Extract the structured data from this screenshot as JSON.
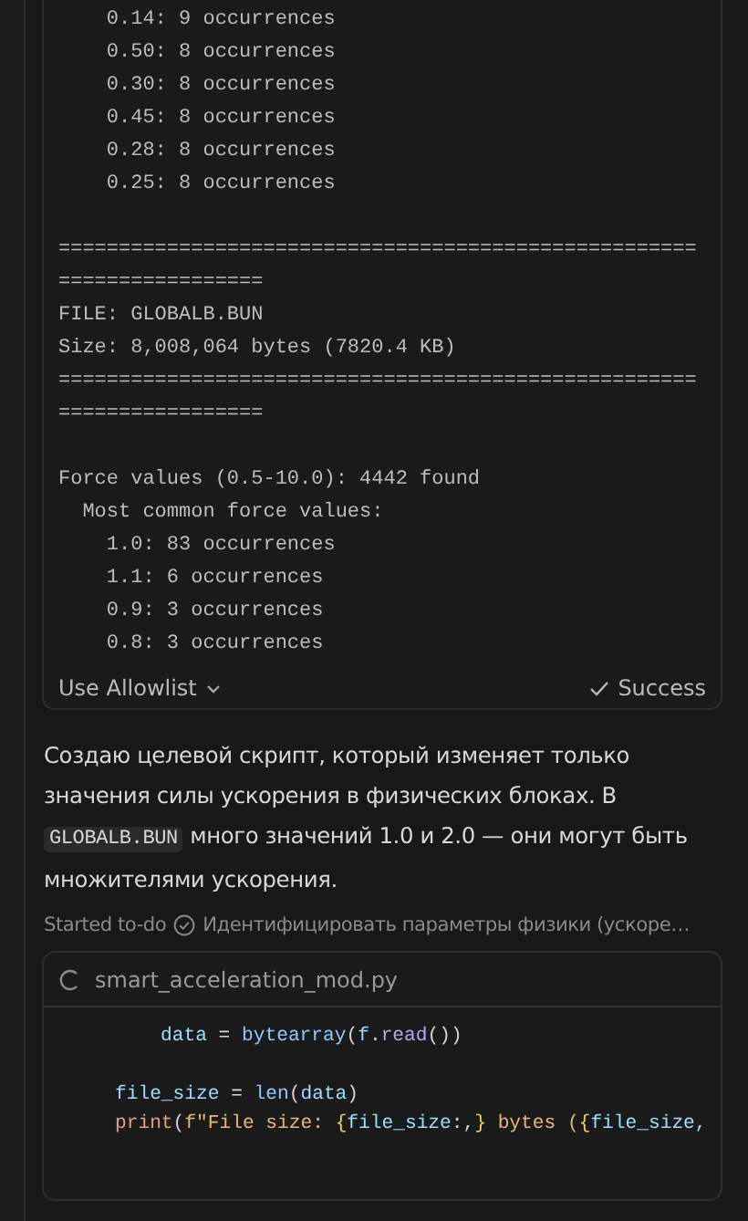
{
  "output": {
    "groups": [
      [
        "    0.14: 9 occurrences",
        "    0.50: 8 occurrences",
        "    0.30: 8 occurrences",
        "    0.45: 8 occurrences",
        "    0.28: 8 occurrences",
        "    0.25: 8 occurrences"
      ],
      [
        "=====================================================",
        "=================",
        "FILE: GLOBALB.BUN",
        "Size: 8,008,064 bytes (7820.4 KB)",
        "=====================================================",
        "================="
      ],
      [
        "Force values (0.5-10.0): 4442 found",
        "  Most common force values:",
        "    1.0: 83 occurrences",
        "    1.1: 6 occurrences",
        "    0.9: 3 occurrences",
        "    0.8: 3 occurrences"
      ]
    ],
    "allowlist": "Use Allowlist",
    "status": "Success"
  },
  "message": [
    {
      "kind": "text",
      "text": "Создаю целевой скрипт, который изменяет только значения силы ускорения в физических блоках. В "
    },
    {
      "kind": "code",
      "text": "GLOBALB.BUN"
    },
    {
      "kind": "text",
      "text": " много значений 1.0 и 2.0 — они могут быть множителями ускорения."
    }
  ],
  "todo": {
    "label": "Started to-do",
    "text": "Идентифицировать параметры физики (ускоре…"
  },
  "file": {
    "name": "smart_acceleration_mod.py",
    "blocks": [
      [
        {
          "kind": "nested",
          "tokens": [
            {
              "kind": "var",
              "text": "data"
            },
            {
              "kind": "plain",
              "text": " = "
            },
            {
              "kind": "func",
              "text": "bytearray"
            },
            {
              "kind": "plain",
              "text": "("
            },
            {
              "kind": "var",
              "text": "f"
            },
            {
              "kind": "plain",
              "text": "."
            },
            {
              "kind": "method",
              "text": "read"
            },
            {
              "kind": "plain",
              "text": "())"
            }
          ]
        }
      ],
      [
        {
          "kind": "block",
          "tokens": [
            {
              "kind": "var",
              "text": "file_size"
            },
            {
              "kind": "plain",
              "text": " = "
            },
            {
              "kind": "func",
              "text": "len"
            },
            {
              "kind": "plain",
              "text": "("
            },
            {
              "kind": "var",
              "text": "data"
            },
            {
              "kind": "plain",
              "text": ")"
            }
          ]
        },
        {
          "kind": "block",
          "tokens": [
            {
              "kind": "keyword",
              "text": "print"
            },
            {
              "kind": "plain",
              "text": "("
            },
            {
              "kind": "str",
              "text": "f\"File size: "
            },
            {
              "kind": "brace",
              "text": "{"
            },
            {
              "kind": "var",
              "text": "file_size"
            },
            {
              "kind": "plain",
              "text": ":,"
            },
            {
              "kind": "brace",
              "text": "}"
            },
            {
              "kind": "str",
              "text": " bytes ("
            },
            {
              "kind": "brace",
              "text": "{"
            },
            {
              "kind": "var",
              "text": "file_size,"
            }
          ]
        }
      ]
    ]
  }
}
